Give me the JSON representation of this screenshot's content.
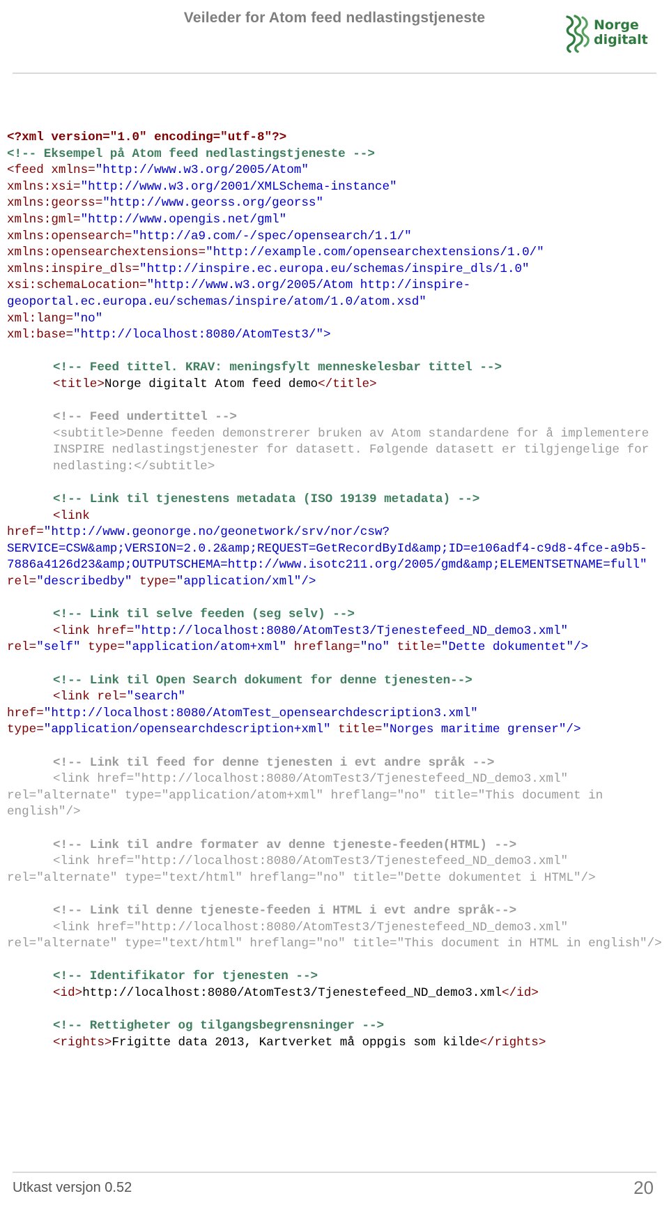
{
  "header": {
    "title": "Veileder for Atom feed nedlastingstjeneste",
    "logo": {
      "name": "norge-digitalt-logo",
      "line1": "Norge",
      "line2": "digitalt"
    }
  },
  "footer": {
    "left": "Utkast versjon 0.52",
    "page_number": "20"
  },
  "code": {
    "lines": [
      {
        "id": "l01",
        "indent": false,
        "parts": [
          {
            "t": "<?xml version=\"1.0\" encoding=\"utf-8\"?>",
            "c": "tag bold"
          }
        ]
      },
      {
        "id": "l02",
        "indent": false,
        "parts": [
          {
            "t": "<!-- Eksempel på Atom feed nedlastingstjeneste -->",
            "c": "cmt"
          }
        ]
      },
      {
        "id": "l03",
        "indent": false,
        "parts": [
          {
            "t": "<feed ",
            "c": "tag"
          },
          {
            "t": "xmlns=",
            "c": "attr"
          },
          {
            "t": "\"http://www.w3.org/2005/Atom\"",
            "c": "val"
          }
        ]
      },
      {
        "id": "l04",
        "indent": false,
        "parts": [
          {
            "t": "xmlns:xsi=",
            "c": "attr"
          },
          {
            "t": "\"http://www.w3.org/2001/XMLSchema-instance\"",
            "c": "val"
          }
        ]
      },
      {
        "id": "l05",
        "indent": false,
        "parts": [
          {
            "t": "xmlns:georss=",
            "c": "attr"
          },
          {
            "t": "\"http://www.georss.org/georss\"",
            "c": "val"
          }
        ]
      },
      {
        "id": "l06",
        "indent": false,
        "parts": [
          {
            "t": "xmlns:gml=",
            "c": "attr"
          },
          {
            "t": "\"http://www.opengis.net/gml\"",
            "c": "val"
          }
        ]
      },
      {
        "id": "l07",
        "indent": false,
        "parts": [
          {
            "t": "xmlns:opensearch=",
            "c": "attr"
          },
          {
            "t": "\"http://a9.com/-/spec/opensearch/1.1/\"",
            "c": "val"
          }
        ]
      },
      {
        "id": "l08",
        "indent": false,
        "parts": [
          {
            "t": "xmlns:opensearchextensions=",
            "c": "attr"
          },
          {
            "t": "\"http://example.com/opensearchextensions/1.0/\"",
            "c": "val"
          }
        ]
      },
      {
        "id": "l09",
        "indent": false,
        "parts": [
          {
            "t": "xmlns:inspire_dls=",
            "c": "attr"
          },
          {
            "t": "\"http://inspire.ec.europa.eu/schemas/inspire_dls/1.0\"",
            "c": "val"
          }
        ]
      },
      {
        "id": "l10",
        "indent": false,
        "parts": [
          {
            "t": "xsi:schemaLocation=",
            "c": "attr"
          },
          {
            "t": "\"http://www.w3.org/2005/Atom http://inspire-geoportal.ec.europa.eu/schemas/inspire/atom/1.0/atom.xsd\"",
            "c": "val"
          }
        ]
      },
      {
        "id": "l11",
        "indent": false,
        "parts": [
          {
            "t": "xml:lang=",
            "c": "attr"
          },
          {
            "t": "\"no\"",
            "c": "val"
          }
        ]
      },
      {
        "id": "l12",
        "indent": false,
        "parts": [
          {
            "t": "xml:base=",
            "c": "attr"
          },
          {
            "t": "\"http://localhost:8080/AtomTest3/\">",
            "c": "val"
          }
        ]
      },
      {
        "id": "sp1",
        "spacer": true
      },
      {
        "id": "l13",
        "indent": true,
        "parts": [
          {
            "t": "<!-- Feed tittel. KRAV: meningsfylt menneskelesbar tittel -->",
            "c": "cmt"
          }
        ]
      },
      {
        "id": "l14",
        "indent": true,
        "parts": [
          {
            "t": "<title>",
            "c": "tag"
          },
          {
            "t": "Norge digitalt Atom feed demo",
            "c": "txt"
          },
          {
            "t": "</title>",
            "c": "tag"
          }
        ]
      },
      {
        "id": "sp2",
        "spacer": true
      },
      {
        "id": "l15",
        "indent": true,
        "parts": [
          {
            "t": "<!-- Feed undertittel -->",
            "c": "cmt-g"
          }
        ]
      },
      {
        "id": "l16",
        "indent": true,
        "parts": [
          {
            "t": "<subtitle>",
            "c": "g-tag"
          },
          {
            "t": "Denne feeden demonstrerer bruken av Atom standardene for å implementere INSPIRE nedlastingstjenester for datasett. Følgende datasett er tilgjengelige for nedlasting:",
            "c": "g-txt"
          },
          {
            "t": "</subtitle>",
            "c": "g-tag"
          }
        ]
      },
      {
        "id": "sp3",
        "spacer": true
      },
      {
        "id": "l17",
        "indent": true,
        "parts": [
          {
            "t": "<!-- Link til tjenestens metadata (ISO 19139 metadata) -->",
            "c": "cmt"
          }
        ]
      },
      {
        "id": "l18",
        "indent": true,
        "parts": [
          {
            "t": "<link",
            "c": "tag"
          }
        ]
      },
      {
        "id": "l19",
        "indent": false,
        "parts": [
          {
            "t": "href=",
            "c": "attr"
          },
          {
            "t": "\"http://www.geonorge.no/geonetwork/srv/nor/csw?SERVICE=CSW&amp;VERSION=2.0.2&amp;REQUEST=GetRecordById&amp;ID=e106adf4-c9d8-4fce-a9b5-7886a4126d23&amp;OUTPUTSCHEMA=http://www.isotc211.org/2005/gmd&amp;ELEMENTSETNAME=full\"",
            "c": "val"
          },
          {
            "t": " rel=",
            "c": "attr"
          },
          {
            "t": "\"describedby\"",
            "c": "val"
          },
          {
            "t": " type=",
            "c": "attr"
          },
          {
            "t": "\"application/xml\"/>",
            "c": "val"
          }
        ]
      },
      {
        "id": "sp4",
        "spacer": true
      },
      {
        "id": "l20",
        "indent": true,
        "parts": [
          {
            "t": "<!-- Link til selve feeden (seg selv) -->",
            "c": "cmt"
          }
        ]
      },
      {
        "id": "l21",
        "indent": true,
        "parts": [
          {
            "t": "<link ",
            "c": "tag"
          },
          {
            "t": "href=",
            "c": "attr"
          },
          {
            "t": "\"http://localhost:8080/AtomTest3/Tjenestefeed_ND_demo3.xml\"",
            "c": "val"
          }
        ]
      },
      {
        "id": "l22",
        "indent": false,
        "parts": [
          {
            "t": "rel=",
            "c": "attr"
          },
          {
            "t": "\"self\"",
            "c": "val"
          },
          {
            "t": " type=",
            "c": "attr"
          },
          {
            "t": "\"application/atom+xml\"",
            "c": "val"
          },
          {
            "t": " hreflang=",
            "c": "attr"
          },
          {
            "t": "\"no\"",
            "c": "val"
          },
          {
            "t": " title=",
            "c": "attr"
          },
          {
            "t": "\"Dette dokumentet\"/>",
            "c": "val"
          }
        ]
      },
      {
        "id": "sp5",
        "spacer": true
      },
      {
        "id": "l23",
        "indent": true,
        "parts": [
          {
            "t": "<!-- Link til Open Search dokument for denne tjenesten-->",
            "c": "cmt"
          }
        ]
      },
      {
        "id": "l24",
        "indent": true,
        "parts": [
          {
            "t": "<link ",
            "c": "tag"
          },
          {
            "t": "rel=",
            "c": "attr"
          },
          {
            "t": "\"search\"",
            "c": "val"
          }
        ]
      },
      {
        "id": "l25",
        "indent": false,
        "parts": [
          {
            "t": "href=",
            "c": "attr"
          },
          {
            "t": "\"http://localhost:8080/AtomTest_opensearchdescription3.xml\"",
            "c": "val"
          }
        ]
      },
      {
        "id": "l26",
        "indent": false,
        "parts": [
          {
            "t": "type=",
            "c": "attr"
          },
          {
            "t": "\"application/opensearchdescription+xml\"",
            "c": "val"
          },
          {
            "t": " title=",
            "c": "attr"
          },
          {
            "t": "\"Norges maritime grenser\"/>",
            "c": "val"
          }
        ]
      },
      {
        "id": "sp6",
        "spacer": true
      },
      {
        "id": "l27",
        "indent": true,
        "parts": [
          {
            "t": "<!-- Link til feed for denne tjenesten i evt andre språk -->",
            "c": "cmt-g"
          }
        ]
      },
      {
        "id": "l28",
        "indent": true,
        "parts": [
          {
            "t": "<link href=",
            "c": "g-tag"
          },
          {
            "t": "\"http://localhost:8080/AtomTest3/Tjenestefeed_ND_demo3.xml\"",
            "c": "g-val"
          }
        ]
      },
      {
        "id": "l29",
        "indent": false,
        "parts": [
          {
            "t": "rel=",
            "c": "g-tag"
          },
          {
            "t": "\"alternate\"",
            "c": "g-val"
          },
          {
            "t": " type=",
            "c": "g-tag"
          },
          {
            "t": "\"application/atom+xml\"",
            "c": "g-val"
          },
          {
            "t": " hreflang=",
            "c": "g-tag"
          },
          {
            "t": "\"no\"",
            "c": "g-val"
          },
          {
            "t": " title=",
            "c": "g-tag"
          },
          {
            "t": "\"This document in english\"/>",
            "c": "g-val"
          }
        ]
      },
      {
        "id": "sp7",
        "spacer": true
      },
      {
        "id": "l30",
        "indent": true,
        "parts": [
          {
            "t": "<!-- Link til andre formater av denne tjeneste-feeden(HTML) -->",
            "c": "cmt-g"
          }
        ]
      },
      {
        "id": "l31",
        "indent": true,
        "parts": [
          {
            "t": "<link href=",
            "c": "g-tag"
          },
          {
            "t": "\"http://localhost:8080/AtomTest3/Tjenestefeed_ND_demo3.xml\"",
            "c": "g-val"
          }
        ]
      },
      {
        "id": "l32",
        "indent": false,
        "parts": [
          {
            "t": "rel=",
            "c": "g-tag"
          },
          {
            "t": "\"alternate\"",
            "c": "g-val"
          },
          {
            "t": " type=",
            "c": "g-tag"
          },
          {
            "t": "\"text/html\"",
            "c": "g-val"
          },
          {
            "t": " hreflang=",
            "c": "g-tag"
          },
          {
            "t": "\"no\"",
            "c": "g-val"
          },
          {
            "t": " title=",
            "c": "g-tag"
          },
          {
            "t": "\"Dette dokumentet i HTML\"/>",
            "c": "g-val"
          }
        ]
      },
      {
        "id": "sp8",
        "spacer": true
      },
      {
        "id": "l33",
        "indent": true,
        "parts": [
          {
            "t": "<!-- Link til denne tjeneste-feeden i HTML i evt andre språk-->",
            "c": "cmt-g"
          }
        ]
      },
      {
        "id": "l34",
        "indent": true,
        "parts": [
          {
            "t": "<link href=",
            "c": "g-tag"
          },
          {
            "t": "\"http://localhost:8080/AtomTest3/Tjenestefeed_ND_demo3.xml\"",
            "c": "g-val"
          }
        ]
      },
      {
        "id": "l35",
        "indent": false,
        "parts": [
          {
            "t": "rel=",
            "c": "g-tag"
          },
          {
            "t": "\"alternate\"",
            "c": "g-val"
          },
          {
            "t": " type=",
            "c": "g-tag"
          },
          {
            "t": "\"text/html\"",
            "c": "g-val"
          },
          {
            "t": " hreflang=",
            "c": "g-tag"
          },
          {
            "t": "\"no\"",
            "c": "g-val"
          },
          {
            "t": " title=",
            "c": "g-tag"
          },
          {
            "t": "\"This document in HTML in english\"/>",
            "c": "g-val"
          }
        ]
      },
      {
        "id": "sp9",
        "spacer": true
      },
      {
        "id": "l36",
        "indent": true,
        "parts": [
          {
            "t": "<!-- Identifikator for tjenesten -->",
            "c": "cmt"
          }
        ]
      },
      {
        "id": "l37",
        "indent": true,
        "parts": [
          {
            "t": "<id>",
            "c": "tag"
          },
          {
            "t": "http://localhost:8080/AtomTest3/Tjenestefeed_ND_demo3.xml",
            "c": "txt"
          },
          {
            "t": "</id>",
            "c": "tag"
          }
        ]
      },
      {
        "id": "sp10",
        "spacer": true
      },
      {
        "id": "l38",
        "indent": true,
        "parts": [
          {
            "t": "<!-- Rettigheter og tilgangsbegrensninger -->",
            "c": "cmt"
          }
        ]
      },
      {
        "id": "l39",
        "indent": true,
        "parts": [
          {
            "t": "<rights>",
            "c": "tag"
          },
          {
            "t": "Frigitte data 2013, Kartverket må oppgis som kilde",
            "c": "txt"
          },
          {
            "t": "</rights>",
            "c": "tag"
          }
        ]
      }
    ]
  }
}
